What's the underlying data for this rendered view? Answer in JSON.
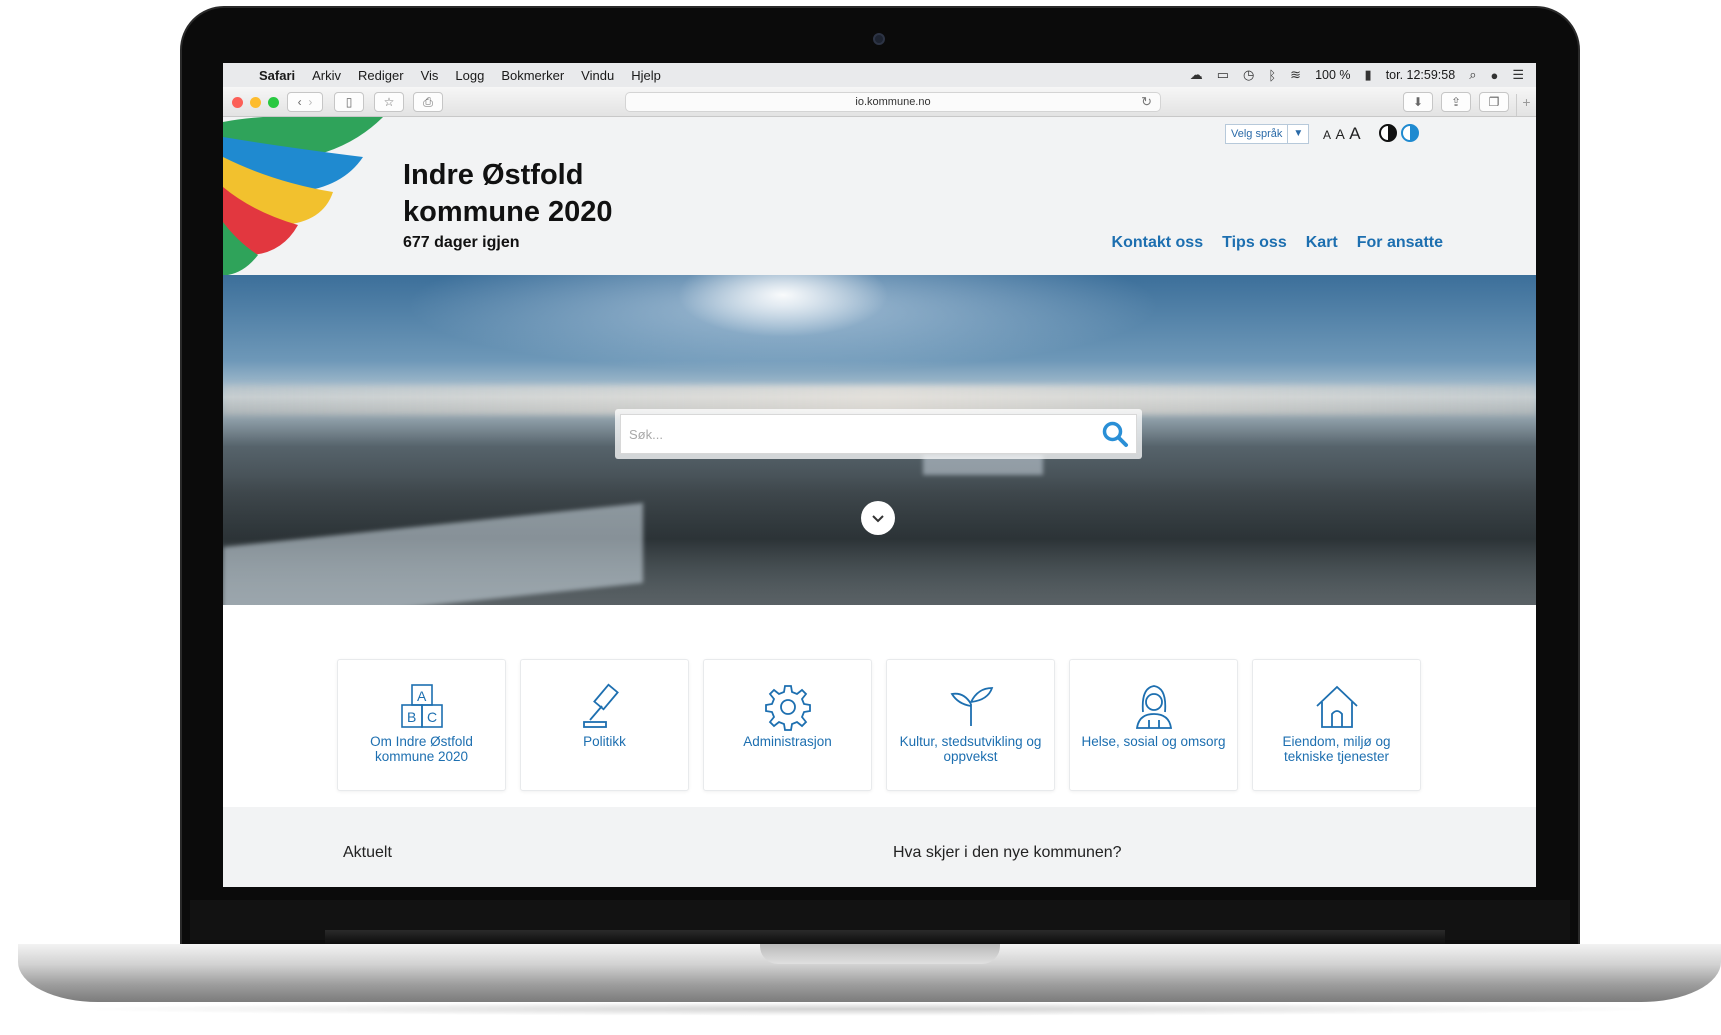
{
  "menubar": {
    "app": "Safari",
    "items": [
      "Arkiv",
      "Rediger",
      "Vis",
      "Logg",
      "Bokmerker",
      "Vindu",
      "Hjelp"
    ],
    "battery": "100 %",
    "clock": "tor. 12:59:58"
  },
  "browser": {
    "url": "io.kommune.no"
  },
  "site": {
    "title_line1": "Indre Østfold",
    "title_line2": "kommune 2020",
    "countdown": "677 dager igjen",
    "language_label": "Velg språk",
    "font_size_small": "A",
    "font_size_medium": "A",
    "font_size_large": "A",
    "nav": [
      "Kontakt oss",
      "Tips oss",
      "Kart",
      "For ansatte"
    ],
    "search_placeholder": "Søk...",
    "tiles": [
      {
        "label": "Om Indre Østfold kommune 2020",
        "icon": "abc-blocks-icon"
      },
      {
        "label": "Politikk",
        "icon": "gavel-icon"
      },
      {
        "label": "Administrasjon",
        "icon": "gear-icon"
      },
      {
        "label": "Kultur, stedsutvikling og oppvekst",
        "icon": "sprout-icon"
      },
      {
        "label": "Helse, sosial og omsorg",
        "icon": "nurse-icon"
      },
      {
        "label": "Eiendom, miljø og tekniske tjenester",
        "icon": "house-icon"
      }
    ],
    "section_left": "Aktuelt",
    "section_right": "Hva skjer i den nye kommunen?"
  },
  "colors": {
    "link_blue": "#1d6fb0",
    "logo_green": "#2fa35a",
    "logo_blue": "#1f8ad0",
    "logo_yellow": "#f2c12e",
    "logo_red": "#e2373f"
  }
}
